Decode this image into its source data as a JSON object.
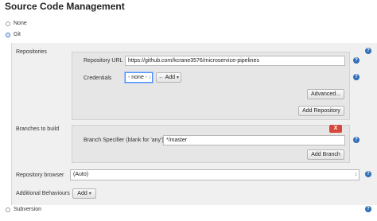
{
  "section": {
    "title": "Source Code Management"
  },
  "scm_options": {
    "none_label": "None",
    "git_label": "Git",
    "subversion_label": "Subversion"
  },
  "repositories": {
    "label": "Repositories",
    "url_label": "Repository URL",
    "url_value": "https://github.com/kcrane3576/microservice-pipelines",
    "credentials_label": "Credentials",
    "credentials_selected": "- none -",
    "add_label": "Add",
    "advanced_label": "Advanced...",
    "add_repository_label": "Add Repository"
  },
  "branches": {
    "label": "Branches to build",
    "delete_label": "X",
    "specifier_label": "Branch Specifier (blank for 'any')",
    "specifier_value": "*/master",
    "add_branch_label": "Add Branch"
  },
  "browser": {
    "label": "Repository browser",
    "selected": "(Auto)"
  },
  "behaviours": {
    "label": "Additional Behaviours",
    "add_label": "Add"
  },
  "help_glyph": "?",
  "colors": {
    "accent": "#3876c2",
    "help": "#2f6fb8",
    "delete": "#d9473a",
    "panel": "#f0f0f0"
  }
}
